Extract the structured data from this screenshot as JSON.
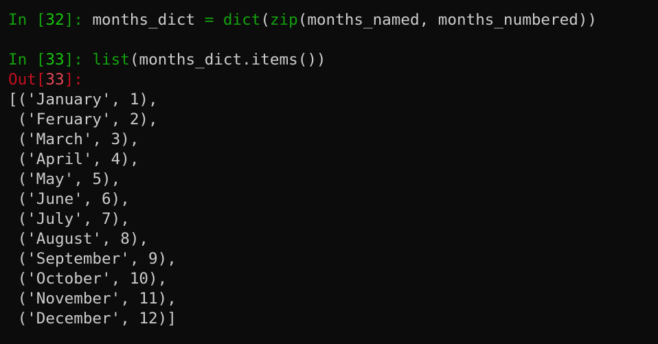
{
  "cells": [
    {
      "prompt": {
        "pre": "In [",
        "num": "32",
        "post": "]: "
      },
      "code": [
        {
          "t": "months_dict ",
          "c": "text"
        },
        {
          "t": "=",
          "c": "op"
        },
        {
          "t": " ",
          "c": "text"
        },
        {
          "t": "dict",
          "c": "builtin"
        },
        {
          "t": "(",
          "c": "text"
        },
        {
          "t": "zip",
          "c": "builtin"
        },
        {
          "t": "(months_named, months_numbered))",
          "c": "text"
        }
      ]
    },
    {
      "prompt": {
        "pre": "In [",
        "num": "33",
        "post": "]: "
      },
      "code": [
        {
          "t": "list",
          "c": "builtin"
        },
        {
          "t": "(months_dict.items())",
          "c": "text"
        }
      ],
      "out_prompt": {
        "pre": "Out[",
        "num": "33",
        "post": "]:"
      },
      "output": [
        "[('January', 1),",
        " ('Feruary', 2),",
        " ('March', 3),",
        " ('April', 4),",
        " ('May', 5),",
        " ('June', 6),",
        " ('July', 7),",
        " ('August', 8),",
        " ('September', 9),",
        " ('October', 10),",
        " ('November', 11),",
        " ('December', 12)]"
      ]
    }
  ],
  "colors": {
    "background": "#0c0c0c",
    "text": "#cccccc",
    "green": "#13a10e",
    "bright_green": "#16c60c",
    "red": "#c50f1f",
    "bright_red": "#e74856"
  }
}
